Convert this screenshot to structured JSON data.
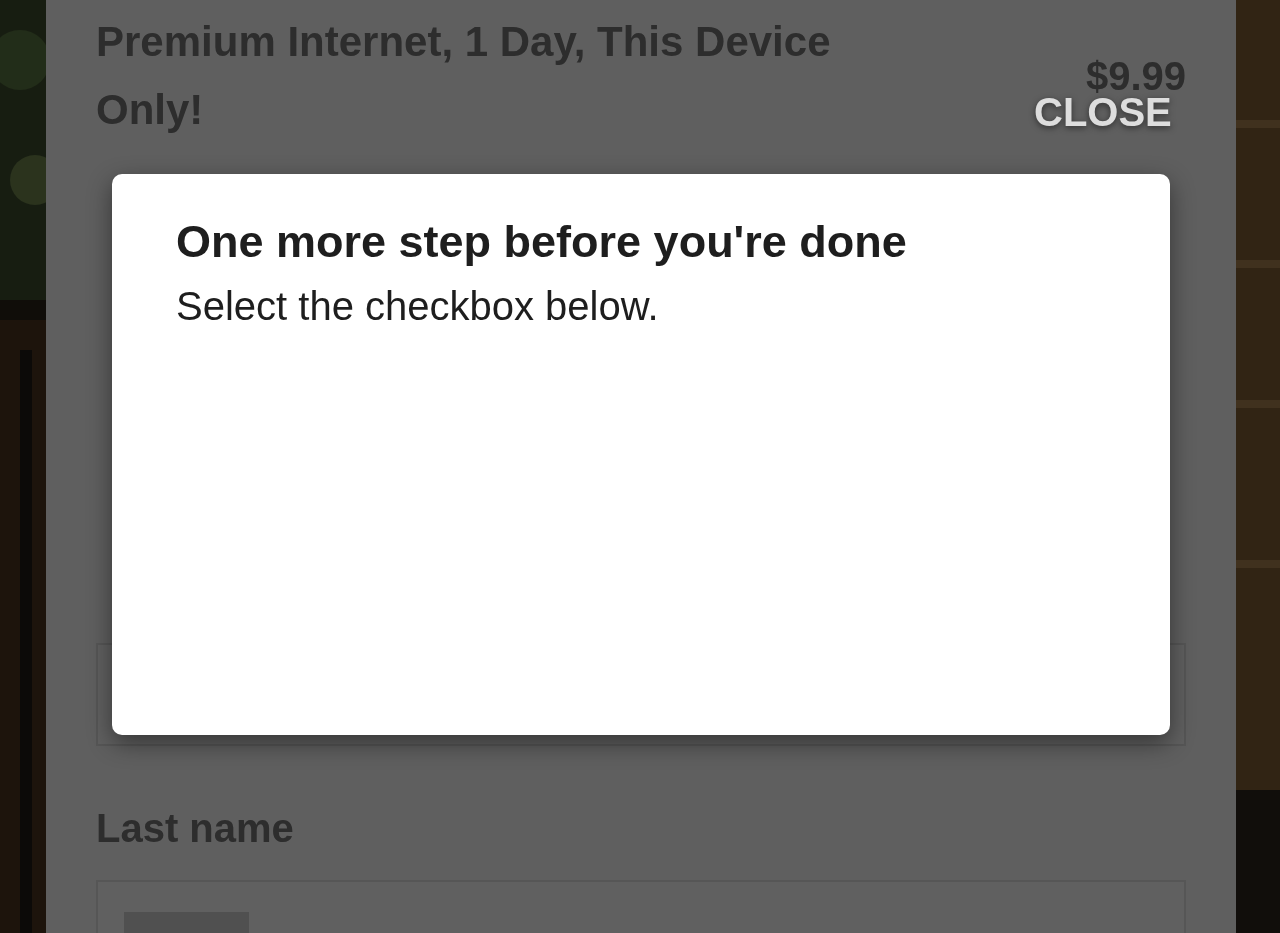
{
  "page": {
    "offer": {
      "title": "Premium Internet, 1 Day, This Device Only!",
      "price": "$9.99"
    },
    "fields": [
      {
        "label": "Last name",
        "value_redacted": true
      }
    ]
  },
  "dialog": {
    "title": "One more step before you're done",
    "message": "Select the checkbox below.",
    "close_button": "CLOSE"
  }
}
